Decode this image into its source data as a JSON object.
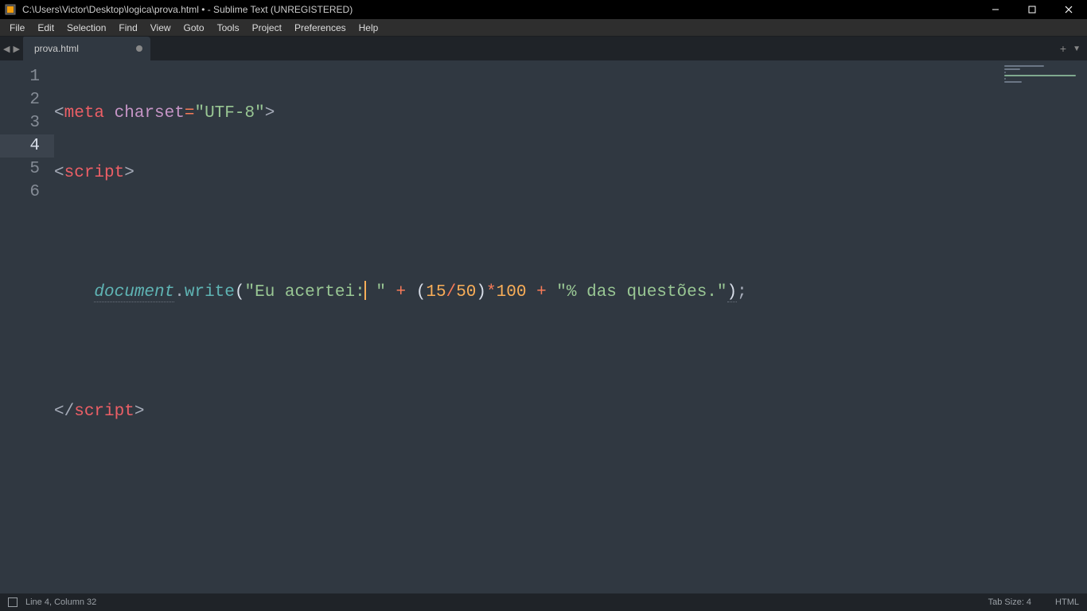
{
  "titlebar": {
    "title": "C:\\Users\\Victor\\Desktop\\logica\\prova.html • - Sublime Text (UNREGISTERED)"
  },
  "menu": {
    "items": [
      "File",
      "Edit",
      "Selection",
      "Find",
      "View",
      "Goto",
      "Tools",
      "Project",
      "Preferences",
      "Help"
    ]
  },
  "tabs": {
    "active": {
      "label": "prova.html",
      "dirty": true
    }
  },
  "editor": {
    "lines": [
      "1",
      "2",
      "3",
      "4",
      "5",
      "6"
    ],
    "active_line": "4",
    "code": {
      "l1_tag": "meta",
      "l1_attr": "charset",
      "l1_val": "\"UTF-8\"",
      "l2_tag": "script",
      "l4_obj": "document",
      "l4_func": "write",
      "l4_str1": "\"Eu acertei:",
      "l4_str1b": " \"",
      "l4_num1": "15",
      "l4_num2": "50",
      "l4_num3": "100",
      "l4_str2": "\"% das questões.\"",
      "l6_tag": "script"
    }
  },
  "statusbar": {
    "position": "Line 4, Column 32",
    "tabsize": "Tab Size: 4",
    "syntax": "HTML"
  }
}
